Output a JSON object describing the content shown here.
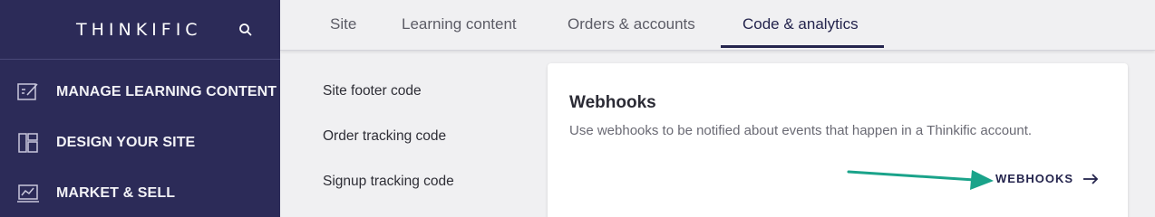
{
  "sidebar": {
    "brand": "THINKIFIC",
    "items": [
      {
        "label": "MANAGE LEARNING CONTENT",
        "icon": "edit-content-icon"
      },
      {
        "label": "DESIGN YOUR SITE",
        "icon": "layout-icon"
      },
      {
        "label": "MARKET & SELL",
        "icon": "chart-presentation-icon"
      }
    ]
  },
  "tabs": [
    {
      "label": "Site"
    },
    {
      "label": "Learning content"
    },
    {
      "label": "Orders & accounts"
    },
    {
      "label": "Code & analytics",
      "active": true
    }
  ],
  "subnav": {
    "items": [
      {
        "label": "Site footer code"
      },
      {
        "label": "Order tracking code"
      },
      {
        "label": "Signup tracking code"
      }
    ]
  },
  "card": {
    "title": "Webhooks",
    "description": "Use webhooks to be notified about events that happen in a Thinkific account.",
    "link_label": "WEBHOOKS"
  },
  "colors": {
    "sidebar_bg": "#2c2b58",
    "accent": "#24244d",
    "annotation_arrow": "#1aa38a"
  }
}
